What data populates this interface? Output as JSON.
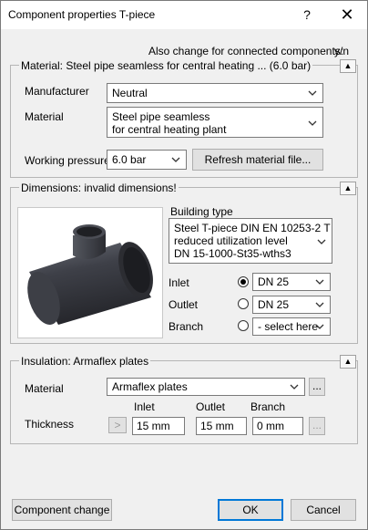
{
  "window": {
    "title": "Component properties T-piece",
    "help_glyph": "?",
    "close_glyph": "✕"
  },
  "connected": {
    "label": "Also change for connected components:",
    "yn": "y/n"
  },
  "material_section": {
    "title": "Material: Steel pipe seamless for central heating ... (6.0 bar)",
    "manufacturer_label": "Manufacturer",
    "manufacturer_value": "Neutral",
    "material_label": "Material",
    "material_value_line1": "Steel pipe seamless",
    "material_value_line2": "for central heating plant",
    "pressure_label": "Working pressure",
    "pressure_value": "6.0 bar",
    "refresh_label": "Refresh material file..."
  },
  "dimensions_section": {
    "title": "Dimensions: invalid dimensions!",
    "building_type_label": "Building type",
    "building_type_line1": "Steel T-piece DIN EN 10253-2 T",
    "building_type_line2": "reduced utilization level",
    "building_type_line3": "DN 15-1000-St35-wths3",
    "inlet_label": "Inlet",
    "inlet_value": "DN 25",
    "outlet_label": "Outlet",
    "outlet_value": "DN 25",
    "branch_label": "Branch",
    "branch_value": "- select here"
  },
  "insulation_section": {
    "title": "Insulation: Armaflex plates",
    "material_label": "Material",
    "material_value": "Armaflex plates",
    "browse_label": "...",
    "col_inlet": "Inlet",
    "col_outlet": "Outlet",
    "col_branch": "Branch",
    "thickness_label": "Thickness",
    "arrow_label": ">",
    "inlet_value": "15 mm",
    "outlet_value": "15 mm",
    "branch_value": "0 mm",
    "branch_browse_label": "..."
  },
  "footer": {
    "component_change": "Component change",
    "ok": "OK",
    "cancel": "Cancel"
  },
  "colors": {
    "accent": "#0078d7",
    "panel": "#f0f0f0",
    "border": "#adadad"
  }
}
